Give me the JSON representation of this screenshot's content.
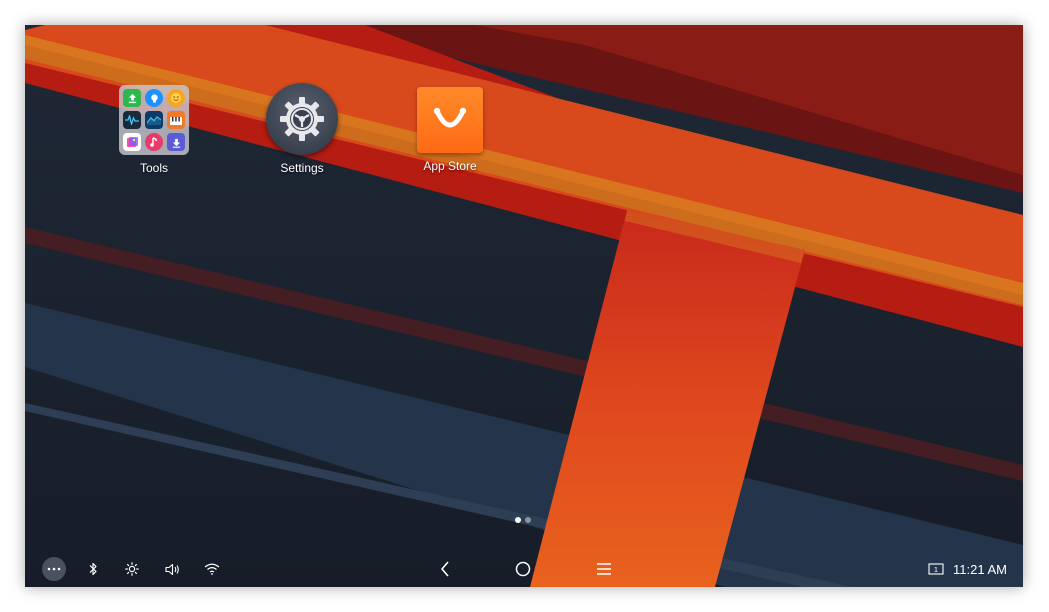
{
  "desktop": {
    "apps": [
      {
        "label": "Tools",
        "icon": "tools-folder-icon"
      },
      {
        "label": "Settings",
        "icon": "gear-icon"
      },
      {
        "label": "App Store",
        "icon": "shopping-bag-smile-icon"
      }
    ],
    "folder_contents": [
      {
        "icon": "upload-icon",
        "color": "#2db84d"
      },
      {
        "icon": "lightbulb-icon",
        "color": "#1e90ff"
      },
      {
        "icon": "chat-emoji-icon",
        "color": "#f5a623"
      },
      {
        "icon": "waveform-icon",
        "color": "#1a2a3a"
      },
      {
        "icon": "mountain-chart-icon",
        "color": "#0d3b66"
      },
      {
        "icon": "piano-icon",
        "color": "#f07a2a"
      },
      {
        "icon": "gallery-icon",
        "color": "#ffffff"
      },
      {
        "icon": "music-note-icon",
        "color": "#e83a6b"
      },
      {
        "icon": "download-icon",
        "color": "#5b5bd6"
      }
    ],
    "page_indicator": {
      "total": 2,
      "active": 0
    }
  },
  "taskbar": {
    "left_icons": [
      "more-icon",
      "bluetooth-icon",
      "brightness-icon",
      "volume-icon",
      "wifi-icon"
    ],
    "nav_icons": [
      "back-icon",
      "home-icon",
      "recents-icon"
    ],
    "screen_badge": "1",
    "clock": "11:21 AM"
  },
  "colors": {
    "wallpaper_dark": "#1b2432",
    "stripe_red": "#c8281c",
    "stripe_orange": "#e8551e",
    "stripe_amber": "#d9741f",
    "stripe_slate": "#24344a",
    "app_store_orange": "#ff6a14"
  }
}
